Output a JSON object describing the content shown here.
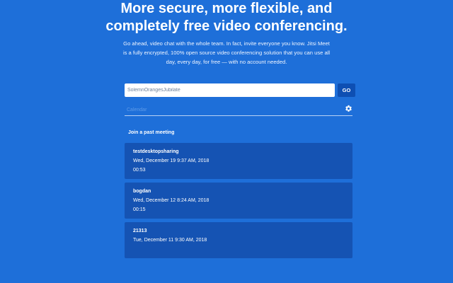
{
  "hero": {
    "title_line1": "More secure, more flexible, and",
    "title_line2": "completely free video conferencing.",
    "description": "Go ahead, video chat with the whole team. In fact, invite everyone you know. Jitsi Meet is a fully encrypted, 100% open source video conferencing solution that you can use all day, every day, for free — with no account needed."
  },
  "join": {
    "room_value": "SolemnOrangesJubilate",
    "go_label": "GO"
  },
  "calendar": {
    "link_label": "Calendar",
    "settings_icon": "gear-icon"
  },
  "past_meetings": {
    "label": "Join a past meeting",
    "items": [
      {
        "name": "testdesktopsharing",
        "date": "Wed, December 19 9:37 AM, 2018",
        "duration": "00:53"
      },
      {
        "name": "bogdan",
        "date": "Wed, December 12 8:24 AM, 2018",
        "duration": "00:15"
      },
      {
        "name": "21313",
        "date": "Tue, December 11 9:30 AM, 2018",
        "duration": ""
      }
    ]
  },
  "colors": {
    "background": "#1e6fd9",
    "card": "#1553b3",
    "button": "#0e4fb3"
  }
}
